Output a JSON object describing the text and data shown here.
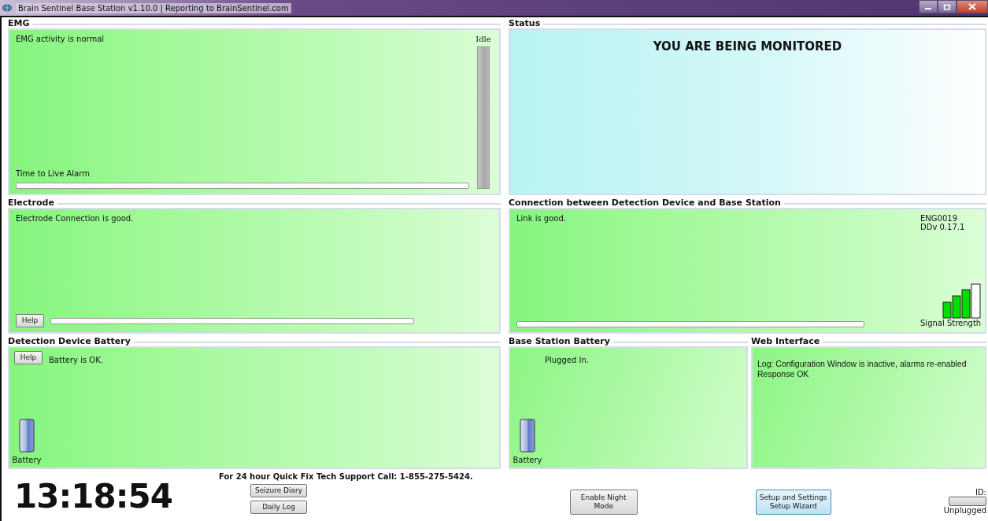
{
  "window": {
    "title": "Brain Sentinel Base Station v1.10.0 | Reporting to BrainSentinel.com"
  },
  "emg": {
    "title": "EMG",
    "message": "EMG activity is normal",
    "activity_label": "Idle",
    "activity_meter": {
      "level": 1
    },
    "alarm_label": "Time to Live Alarm",
    "alarm_progress": {
      "level": 0
    }
  },
  "status": {
    "title": "Status",
    "message": "YOU ARE BEING MONITORED"
  },
  "electrode": {
    "title": "Electrode",
    "message": "Electrode Connection is good.",
    "help_button": "Help",
    "progress": {
      "level": 0
    }
  },
  "connection": {
    "title": "Connection between Detection Device and Base Station",
    "message": "Link is good.",
    "device_id": "ENG0019",
    "device_version": "DDv 0.17.1",
    "progress": {
      "level": 0
    },
    "signal_label": "Signal Strength"
  },
  "detection_battery": {
    "title": "Detection Device Battery",
    "help_button": "Help",
    "message": "Battery is OK.",
    "battery_label": "Battery"
  },
  "base_battery": {
    "title": "Base Station Battery",
    "message": "Plugged In.",
    "battery_label": "Battery"
  },
  "web_interface": {
    "title": "Web Interface",
    "log_lines": [
      "Log: Configuration Window is inactive, alarms re-enabled",
      "Response OK"
    ]
  },
  "footer": {
    "clock": "13:18:54",
    "support_text": "For 24 hour Quick Fix Tech Support Call: 1-855-275-5424.",
    "buttons": [
      "Seizure Diary",
      "Daily Log"
    ],
    "night_mode_button": "Enable Night Mode",
    "setup_button_lines": [
      "Setup and Settings",
      "Setup Wizard"
    ],
    "id_label": "ID:",
    "id_status": "Unplugged"
  }
}
